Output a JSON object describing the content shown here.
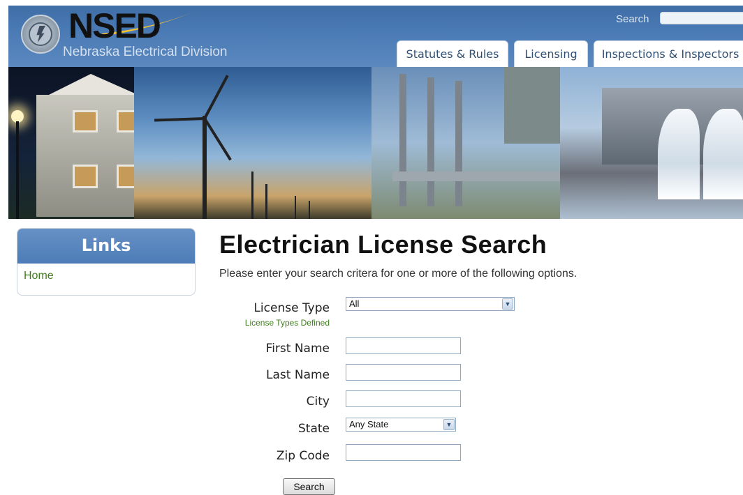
{
  "header": {
    "brand": "NSED",
    "subtitle": "Nebraska Electrical Division",
    "search_label": "Search",
    "tabs": [
      {
        "label": "Statutes & Rules"
      },
      {
        "label": "Licensing"
      },
      {
        "label": "Inspections & Inspectors"
      }
    ]
  },
  "sidebar": {
    "title": "Links",
    "items": [
      {
        "label": "Home"
      }
    ]
  },
  "main": {
    "title": "Electrician License Search",
    "intro": "Please enter your search critera for one or more of the following options.",
    "license_type": {
      "label": "License Type",
      "value": "All",
      "help_link": "License Types Defined"
    },
    "first_name": {
      "label": "First Name",
      "value": ""
    },
    "last_name": {
      "label": "Last Name",
      "value": ""
    },
    "city": {
      "label": "City",
      "value": ""
    },
    "state": {
      "label": "State",
      "value": "Any State"
    },
    "zip": {
      "label": "Zip Code",
      "value": ""
    },
    "search_button": "Search"
  },
  "colors": {
    "header_blue": "#4a7ab4",
    "link_green": "#3f7d1e",
    "tab_text": "#2f4f74"
  }
}
